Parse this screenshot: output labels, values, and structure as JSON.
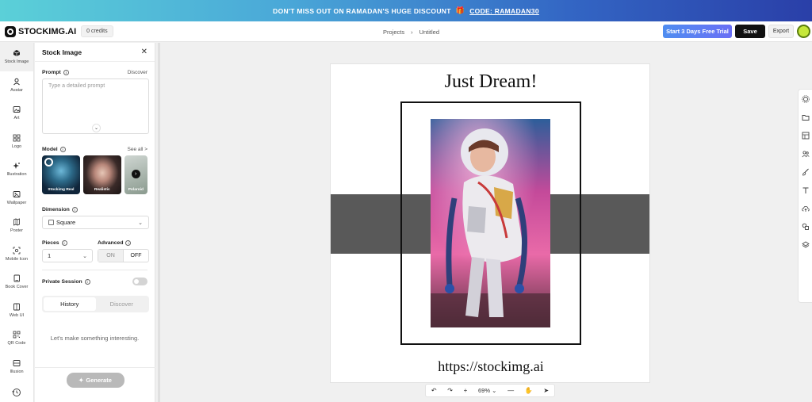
{
  "banner": {
    "text": "DON'T MISS OUT ON RAMADAN'S HUGE DISCOUNT",
    "code": "CODE: RAMADAN30"
  },
  "topbar": {
    "brand": "STOCKIMG.AI",
    "credits": "0 credits",
    "breadcrumb": [
      "Projects",
      "Untitled"
    ],
    "trial_label": "Start 3 Days Free Trial",
    "save_label": "Save",
    "export_label": "Export"
  },
  "rail": {
    "items": [
      {
        "label": "Stock Image",
        "icon": "cube-icon"
      },
      {
        "label": "Avatar",
        "icon": "user-icon"
      },
      {
        "label": "Art",
        "icon": "image-icon"
      },
      {
        "label": "Logo",
        "icon": "grid-icon"
      },
      {
        "label": "Illustration",
        "icon": "sparkle-icon"
      },
      {
        "label": "Wallpaper",
        "icon": "wallpaper-icon"
      },
      {
        "label": "Poster",
        "icon": "poster-icon"
      },
      {
        "label": "Mobile Icon",
        "icon": "mobile-icon"
      },
      {
        "label": "Book Cover",
        "icon": "book-icon"
      },
      {
        "label": "Web UI",
        "icon": "web-icon"
      },
      {
        "label": "QR Code",
        "icon": "qr-icon"
      },
      {
        "label": "Illusion",
        "icon": "illusion-icon"
      }
    ]
  },
  "panel": {
    "title": "Stock Image",
    "prompt_label": "Prompt",
    "prompt_link": "Discover",
    "prompt_placeholder": "Type a detailed prompt",
    "model_label": "Model",
    "model_link": "See all >",
    "models": [
      {
        "name": "Stockimg Real"
      },
      {
        "name": "Realistic"
      },
      {
        "name": "Polaroid"
      }
    ],
    "dimension_label": "Dimension",
    "dimension_value": "Square",
    "pieces_label": "Pieces",
    "pieces_value": "1",
    "advanced_label": "Advanced",
    "advanced_on": "ON",
    "advanced_off": "OFF",
    "private_label": "Private Session",
    "tabs": [
      "History",
      "Discover"
    ],
    "empty_message": "Let's make something interesting.",
    "generate_label": "Generate"
  },
  "canvas": {
    "title_text": "Just Dream!",
    "url_text": "https://stockimg.ai",
    "zoom": "69%"
  },
  "colors": {
    "accent": "#4f8df0",
    "band": "#595959"
  }
}
